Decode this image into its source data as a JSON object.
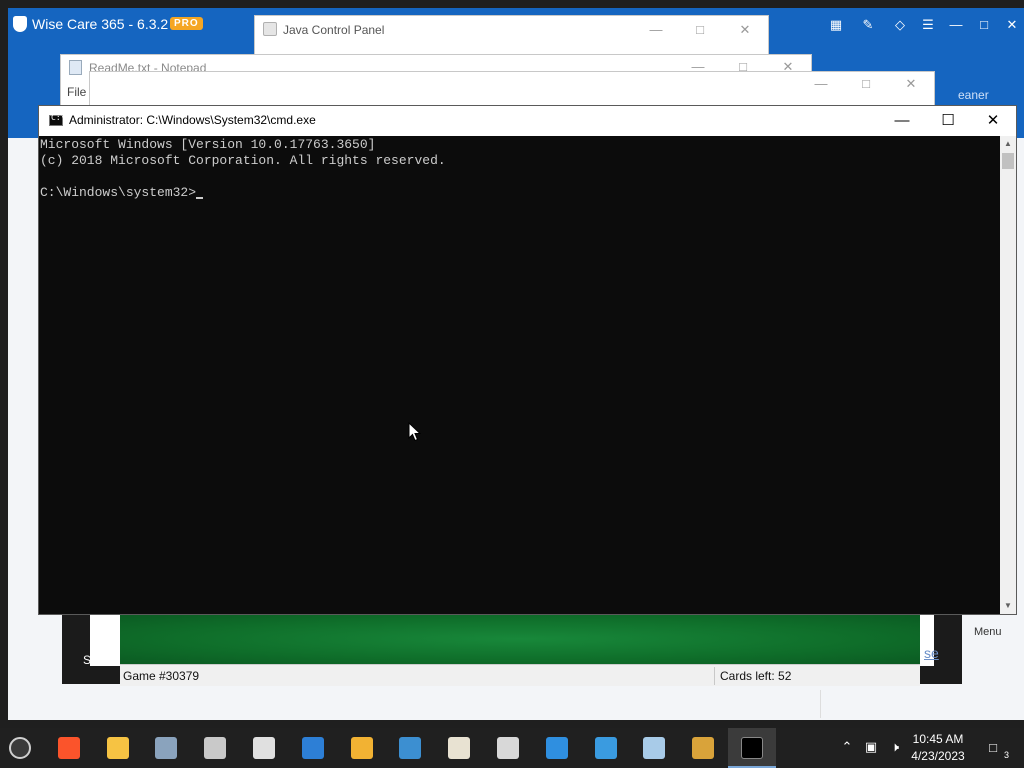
{
  "wise_care": {
    "title": "Wise Care 365 - 6.3.2",
    "badge": "PRO",
    "cleaner_fragment": "eaner",
    "menu_label": "Menu",
    "share_label": "Share",
    "blue_fragment": "se",
    "icons": [
      "feedback-icon",
      "edit-icon",
      "skin-icon",
      "menu-icon",
      "minimize-icon",
      "maximize-icon",
      "close-icon"
    ]
  },
  "java_panel": {
    "title": "Java Control Panel"
  },
  "notepad": {
    "title": "ReadMe.txt - Notepad",
    "menu_file": "File"
  },
  "solitaire": {
    "game_label": "Game #30379",
    "cards_left": "Cards left: 52"
  },
  "cmd": {
    "title": "Administrator: C:\\Windows\\System32\\cmd.exe",
    "lines": [
      "Microsoft Windows [Version 10.0.17763.3650]",
      "(c) 2018 Microsoft Corporation. All rights reserved.",
      "",
      "C:\\Windows\\system32>"
    ]
  },
  "taskbar": {
    "apps": [
      {
        "name": "start-icon",
        "color": "#9a9a9a"
      },
      {
        "name": "brave-browser-icon",
        "color": "#fb542b"
      },
      {
        "name": "file-explorer-icon",
        "color": "#f6c343"
      },
      {
        "name": "network-tool-icon",
        "color": "#8aa3bd"
      },
      {
        "name": "task-view-icon",
        "color": "#c9c9c9"
      },
      {
        "name": "settings-icon",
        "color": "#e0e0e0"
      },
      {
        "name": "wise-care-icon",
        "color": "#2d7fd6"
      },
      {
        "name": "wise-toolbox-icon",
        "color": "#f2b233"
      },
      {
        "name": "system-monitor-icon",
        "color": "#3c8fd1"
      },
      {
        "name": "java-icon",
        "color": "#e8e2d2"
      },
      {
        "name": "calendar-321-icon",
        "color": "#d8d8d8"
      },
      {
        "name": "internet-explorer-icon",
        "color": "#2f8fe0"
      },
      {
        "name": "cortana-icon",
        "color": "#3a9be0"
      },
      {
        "name": "notepad-icon",
        "color": "#a8cbe8"
      },
      {
        "name": "solitaire-icon",
        "color": "#d9a33a"
      },
      {
        "name": "command-prompt-icon",
        "color": "#000000"
      }
    ],
    "time": "10:45 AM",
    "date": "4/23/2023",
    "notification_count": "3"
  }
}
